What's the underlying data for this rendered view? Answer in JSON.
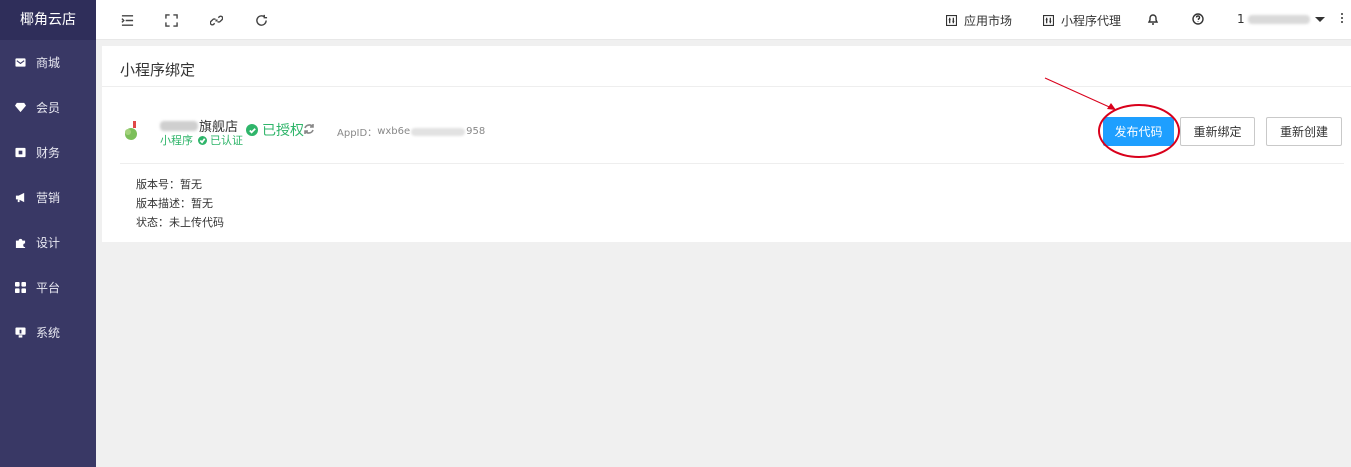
{
  "brand": "椰角云店",
  "sidebar": {
    "items": [
      {
        "label": "商城",
        "icon": "mail-icon"
      },
      {
        "label": "会员",
        "icon": "diamond-icon"
      },
      {
        "label": "财务",
        "icon": "wallet-icon"
      },
      {
        "label": "营销",
        "icon": "megaphone-icon"
      },
      {
        "label": "设计",
        "icon": "puzzle-icon"
      },
      {
        "label": "平台",
        "icon": "grid-icon"
      },
      {
        "label": "系统",
        "icon": "monitor-icon"
      }
    ]
  },
  "topbar": {
    "app_market": "应用市场",
    "mini_agent": "小程序代理",
    "user_prefix": "1"
  },
  "card": {
    "title": "小程序绑定",
    "store_name_suffix": "旗舰店",
    "type_label": "小程序",
    "verified_label": "已认证",
    "authorized_label": "已授权",
    "appid_label": "AppID：",
    "appid_prefix": "wxb6e",
    "appid_suffix": "958",
    "buttons": {
      "publish": "发布代码",
      "rebind": "重新绑定",
      "recreate": "重新创建"
    },
    "meta": {
      "version": "版本号：暂无",
      "description": "版本描述：暂无",
      "status": "状态：未上传代码"
    }
  },
  "colors": {
    "sidebar_bg": "#393865",
    "primary": "#1e9fff",
    "success": "#2fb56a",
    "annotation": "#d9001b"
  }
}
